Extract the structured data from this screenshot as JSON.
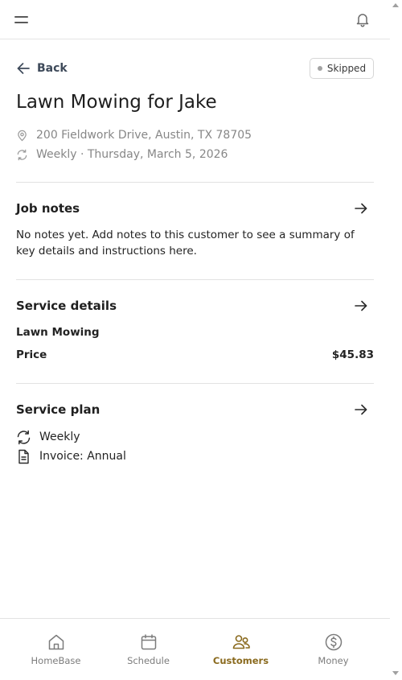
{
  "header": {
    "back_label": "Back",
    "status": "Skipped"
  },
  "job": {
    "title": "Lawn Mowing for Jake",
    "address": "200 Fieldwork Drive, Austin, TX 78705",
    "schedule": "Weekly · Thursday, March 5, 2026"
  },
  "job_notes": {
    "title": "Job notes",
    "text": "No notes yet. Add notes to this customer to see a summary of key details and instructions here."
  },
  "service_details": {
    "title": "Service details",
    "service_name": "Lawn Mowing",
    "price_label": "Price",
    "price_value": "$45.83"
  },
  "service_plan": {
    "title": "Service plan",
    "frequency": "Weekly",
    "invoice": "Invoice: Annual"
  },
  "bottom_nav": {
    "items": [
      {
        "label": "HomeBase",
        "icon": "home-icon"
      },
      {
        "label": "Schedule",
        "icon": "calendar-icon"
      },
      {
        "label": "Customers",
        "icon": "customers-icon"
      },
      {
        "label": "Money",
        "icon": "dollar-icon"
      }
    ],
    "active": "Customers"
  },
  "colors": {
    "accent": "#8a6a1e",
    "muted_text": "#878787",
    "divider": "#e2e2e2"
  }
}
